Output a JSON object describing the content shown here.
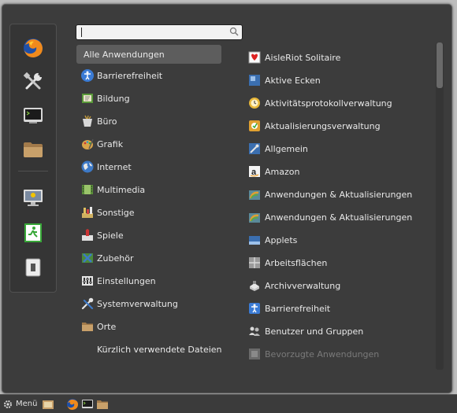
{
  "menu": {
    "search": {
      "value": ""
    },
    "favorites": [
      "firefox-icon",
      "settings-tools-icon",
      "terminal-icon",
      "folder-icon",
      "lock-screen-icon",
      "logout-icon",
      "shutdown-icon"
    ],
    "categories": [
      {
        "label": "Alle Anwendungen"
      },
      {
        "label": "Barrierefreiheit"
      },
      {
        "label": "Bildung"
      },
      {
        "label": "Büro"
      },
      {
        "label": "Grafik"
      },
      {
        "label": "Internet"
      },
      {
        "label": "Multimedia"
      },
      {
        "label": "Sonstige"
      },
      {
        "label": "Spiele"
      },
      {
        "label": "Zubehör"
      },
      {
        "label": "Einstellungen"
      },
      {
        "label": "Systemverwaltung"
      },
      {
        "label": "Orte"
      },
      {
        "label": "Kürzlich verwendete Dateien"
      }
    ],
    "apps": [
      {
        "label": "AisleRiot Solitaire"
      },
      {
        "label": "Aktive Ecken"
      },
      {
        "label": "Aktivitätsprotokollverwaltung"
      },
      {
        "label": "Aktualisierungsverwaltung"
      },
      {
        "label": "Allgemein"
      },
      {
        "label": "Amazon"
      },
      {
        "label": "Anwendungen & Aktualisierungen"
      },
      {
        "label": "Anwendungen & Aktualisierungen"
      },
      {
        "label": "Applets"
      },
      {
        "label": "Arbeitsflächen"
      },
      {
        "label": "Archivverwaltung"
      },
      {
        "label": "Barrierefreiheit"
      },
      {
        "label": "Benutzer und Gruppen"
      },
      {
        "label": "Bevorzugte Anwendungen"
      }
    ]
  },
  "panel": {
    "menu_label": "Menü"
  }
}
